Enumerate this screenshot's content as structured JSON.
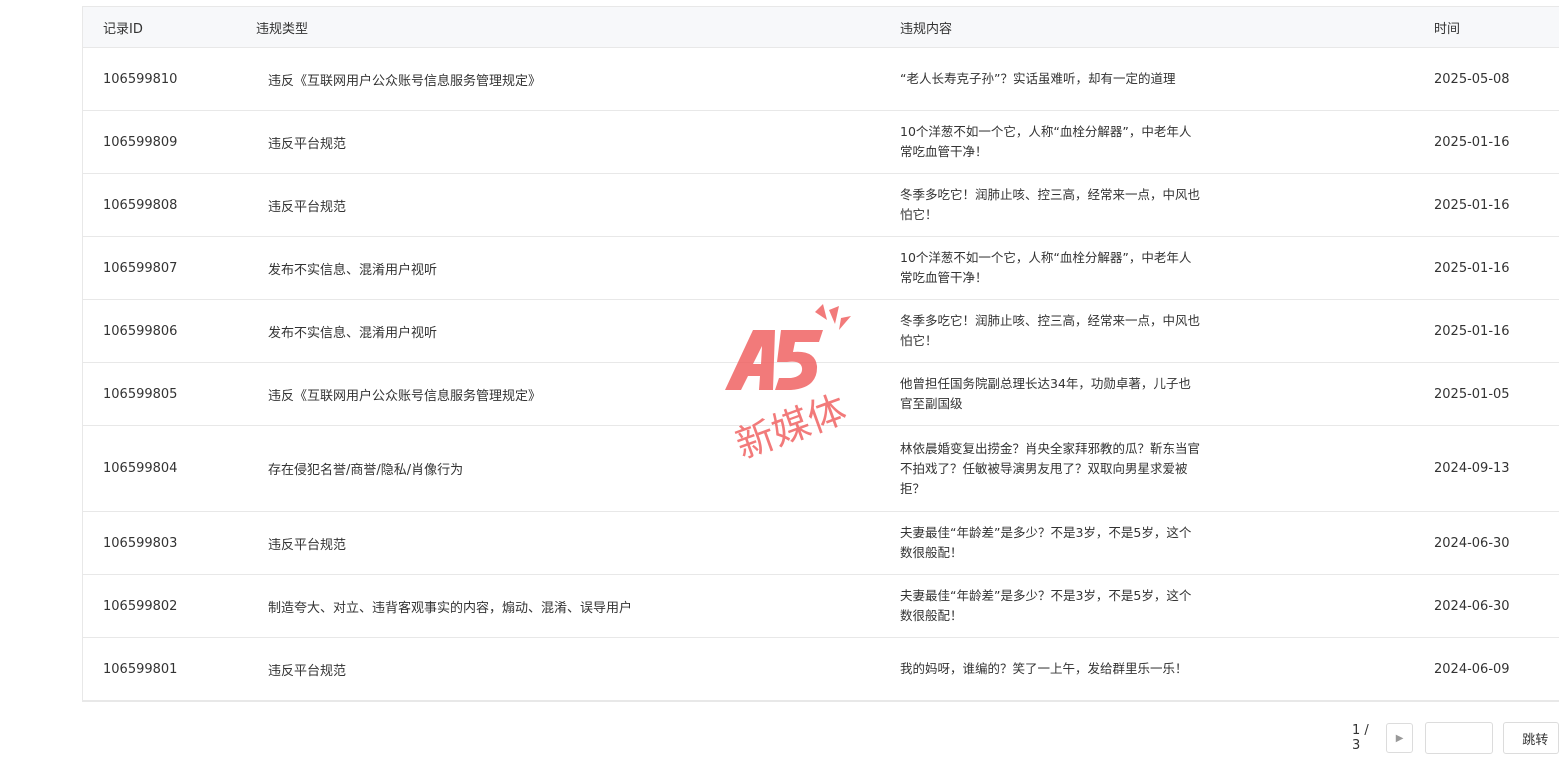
{
  "table": {
    "headers": [
      "记录ID",
      "违规类型",
      "违规内容",
      "时间"
    ],
    "rows": [
      {
        "id": "106599810",
        "type": "违反《互联网用户公众账号信息服务管理规定》",
        "content": "“老人长寿克子孙”？实话虽难听，却有一定的道理",
        "time": "2025-05-08"
      },
      {
        "id": "106599809",
        "type": "违反平台规范",
        "content": "10个洋葱不如一个它，人称“血栓分解器”，中老年人常吃血管干净！",
        "time": "2025-01-16"
      },
      {
        "id": "106599808",
        "type": "违反平台规范",
        "content": "冬季多吃它！润肺止咳、控三高，经常来一点，中风也怕它！",
        "time": "2025-01-16"
      },
      {
        "id": "106599807",
        "type": "发布不实信息、混淆用户视听",
        "content": "10个洋葱不如一个它，人称“血栓分解器”，中老年人常吃血管干净！",
        "time": "2025-01-16"
      },
      {
        "id": "106599806",
        "type": "发布不实信息、混淆用户视听",
        "content": "冬季多吃它！润肺止咳、控三高，经常来一点，中风也怕它！",
        "time": "2025-01-16"
      },
      {
        "id": "106599805",
        "type": "违反《互联网用户公众账号信息服务管理规定》",
        "content": "他曾担任国务院副总理长达34年，功勋卓著，儿子也官至副国级",
        "time": "2025-01-05"
      },
      {
        "id": "106599804",
        "type": "存在侵犯名誉/商誉/隐私/肖像行为",
        "content": "林依晨婚变复出捞金？肖央全家拜邪教的瓜？靳东当官不拍戏了？任敏被导演男友甩了？双取向男星求爱被拒？",
        "time": "2024-09-13"
      },
      {
        "id": "106599803",
        "type": "违反平台规范",
        "content": "夫妻最佳“年龄差”是多少？不是3岁，不是5岁，这个数很般配！",
        "time": "2024-06-30"
      },
      {
        "id": "106599802",
        "type": "制造夸大、对立、违背客观事实的内容，煽动、混淆、误导用户",
        "content": "夫妻最佳“年龄差”是多少？不是3岁，不是5岁，这个数很般配！",
        "time": "2024-06-30"
      },
      {
        "id": "106599801",
        "type": "违反平台规范",
        "content": "我的妈呀，谁编的？笑了一上午，发给群里乐一乐！",
        "time": "2024-06-09"
      }
    ]
  },
  "pager": {
    "page_text": "1 / 3",
    "jump_label": "跳转"
  },
  "watermark": {
    "logo_text": "A5",
    "sub_text": "新媒体",
    "color": "#f05a5a"
  }
}
